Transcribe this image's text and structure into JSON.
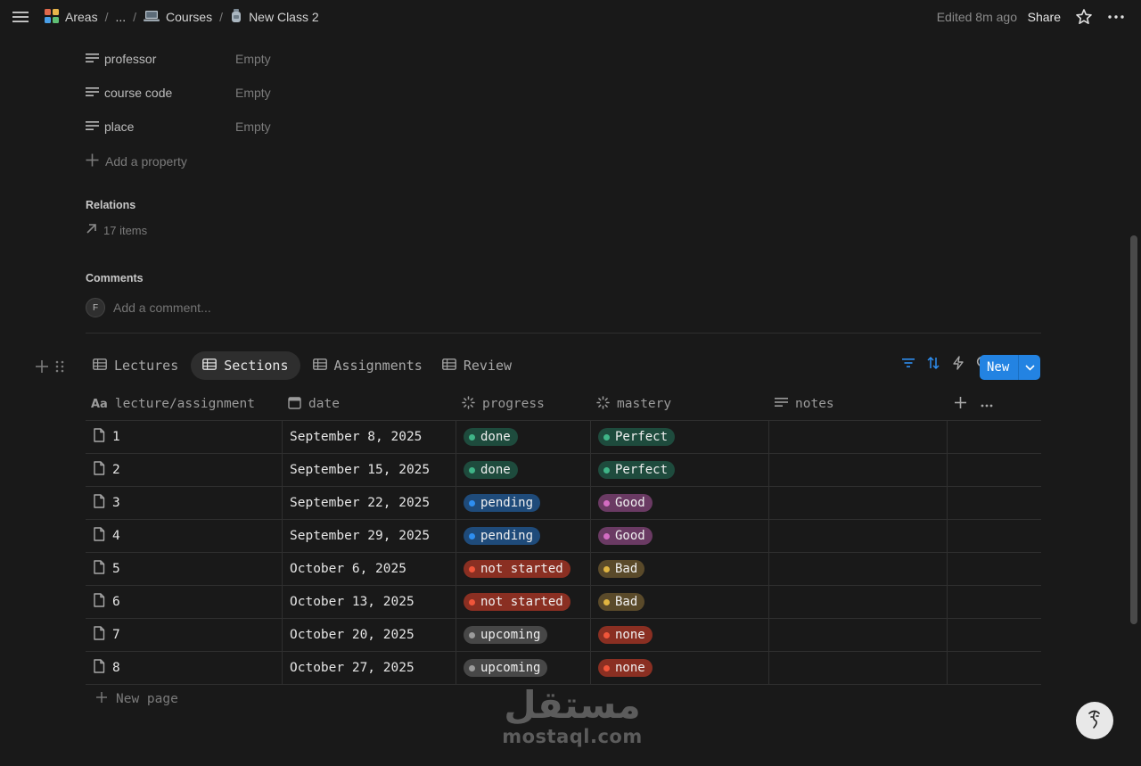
{
  "breadcrumb": {
    "items": [
      {
        "label": "Areas",
        "icon": "grid-icon"
      },
      {
        "label": "..."
      },
      {
        "label": "Courses",
        "icon": "laptop-icon"
      },
      {
        "label": "New Class 2",
        "icon": "bottle-icon"
      }
    ]
  },
  "header": {
    "edited": "Edited 8m ago",
    "share": "Share"
  },
  "properties": [
    {
      "name": "professor",
      "value": "Empty"
    },
    {
      "name": "course code",
      "value": "Empty"
    },
    {
      "name": "place",
      "value": "Empty"
    }
  ],
  "add_property": "Add a property",
  "relations": {
    "title": "Relations",
    "items": "17 items"
  },
  "comments": {
    "title": "Comments",
    "avatar": "F",
    "placeholder": "Add a comment..."
  },
  "views": {
    "tabs": [
      {
        "label": "Lectures",
        "active": false
      },
      {
        "label": "Sections",
        "active": true
      },
      {
        "label": "Assignments",
        "active": false
      },
      {
        "label": "Review",
        "active": false
      }
    ],
    "new_button": "New"
  },
  "table": {
    "columns": [
      {
        "label": "lecture/assignment",
        "icon": "title-icon"
      },
      {
        "label": "date",
        "icon": "calendar-icon"
      },
      {
        "label": "progress",
        "icon": "status-icon"
      },
      {
        "label": "mastery",
        "icon": "status-icon"
      },
      {
        "label": "notes",
        "icon": "text-icon"
      }
    ],
    "rows": [
      {
        "name": "1",
        "date": "September 8, 2025",
        "progress": "done",
        "mastery": "Perfect"
      },
      {
        "name": "2",
        "date": "September 15, 2025",
        "progress": "done",
        "mastery": "Perfect"
      },
      {
        "name": "3",
        "date": "September 22, 2025",
        "progress": "pending",
        "mastery": "Good"
      },
      {
        "name": "4",
        "date": "September 29, 2025",
        "progress": "pending",
        "mastery": "Good"
      },
      {
        "name": "5",
        "date": "October 6, 2025",
        "progress": "not started",
        "mastery": "Bad"
      },
      {
        "name": "6",
        "date": "October 13, 2025",
        "progress": "not started",
        "mastery": "Bad"
      },
      {
        "name": "7",
        "date": "October 20, 2025",
        "progress": "upcoming",
        "mastery": "none"
      },
      {
        "name": "8",
        "date": "October 27, 2025",
        "progress": "upcoming",
        "mastery": "none"
      }
    ],
    "new_page": "New page"
  },
  "status_colors": {
    "done": {
      "bg": "#1e4b3d",
      "dot": "#3fb487"
    },
    "pending": {
      "bg": "#1f4b7a",
      "dot": "#2e8ef0"
    },
    "not started": {
      "bg": "#8a2f22",
      "dot": "#f0553a"
    },
    "upcoming": {
      "bg": "#474747",
      "dot": "#9b9b9b"
    },
    "Perfect": {
      "bg": "#1e4b3d",
      "dot": "#3fb487"
    },
    "Good": {
      "bg": "#6a3a63",
      "dot": "#d36cc2"
    },
    "Bad": {
      "bg": "#5a4a2a",
      "dot": "#e0b541"
    },
    "none": {
      "bg": "#8a2f22",
      "dot": "#f0553a"
    }
  },
  "watermark": {
    "arabic": "مستقل",
    "latin": "mostaql.com"
  },
  "accent": "#2383e2"
}
